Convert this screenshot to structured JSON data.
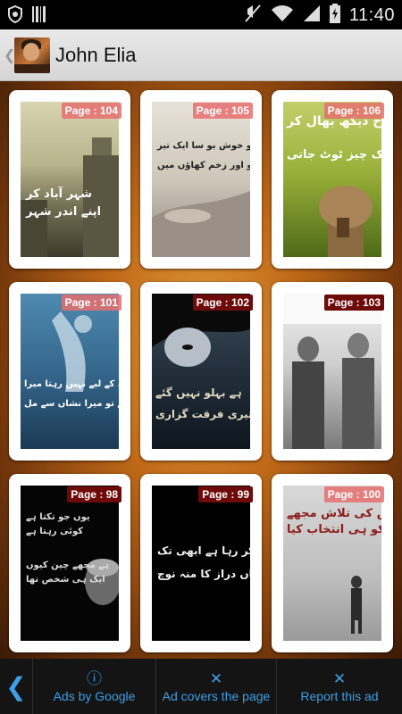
{
  "status_bar": {
    "time": "11:40"
  },
  "header": {
    "title": "John Elia"
  },
  "cards": [
    {
      "page": "Page : 104",
      "badge_style": "pink"
    },
    {
      "page": "Page : 105",
      "badge_style": "pink"
    },
    {
      "page": "Page : 106",
      "badge_style": "pink"
    },
    {
      "page": "Page : 101",
      "badge_style": "pink"
    },
    {
      "page": "Page : 102",
      "badge_style": "dark"
    },
    {
      "page": "Page : 103",
      "badge_style": "dark"
    },
    {
      "page": "Page : 98",
      "badge_style": "dark"
    },
    {
      "page": "Page : 99",
      "badge_style": "dark"
    },
    {
      "page": "Page : 100",
      "badge_style": "pink"
    }
  ],
  "ad_bar": {
    "ads_by_google": "Ads by Google",
    "ad_covers": "Ad covers the page",
    "report": "Report this ad"
  },
  "colors": {
    "accent": "#3e9ee6",
    "badge_pink": "#e66e6e",
    "badge_dark": "#6e0a0a"
  }
}
